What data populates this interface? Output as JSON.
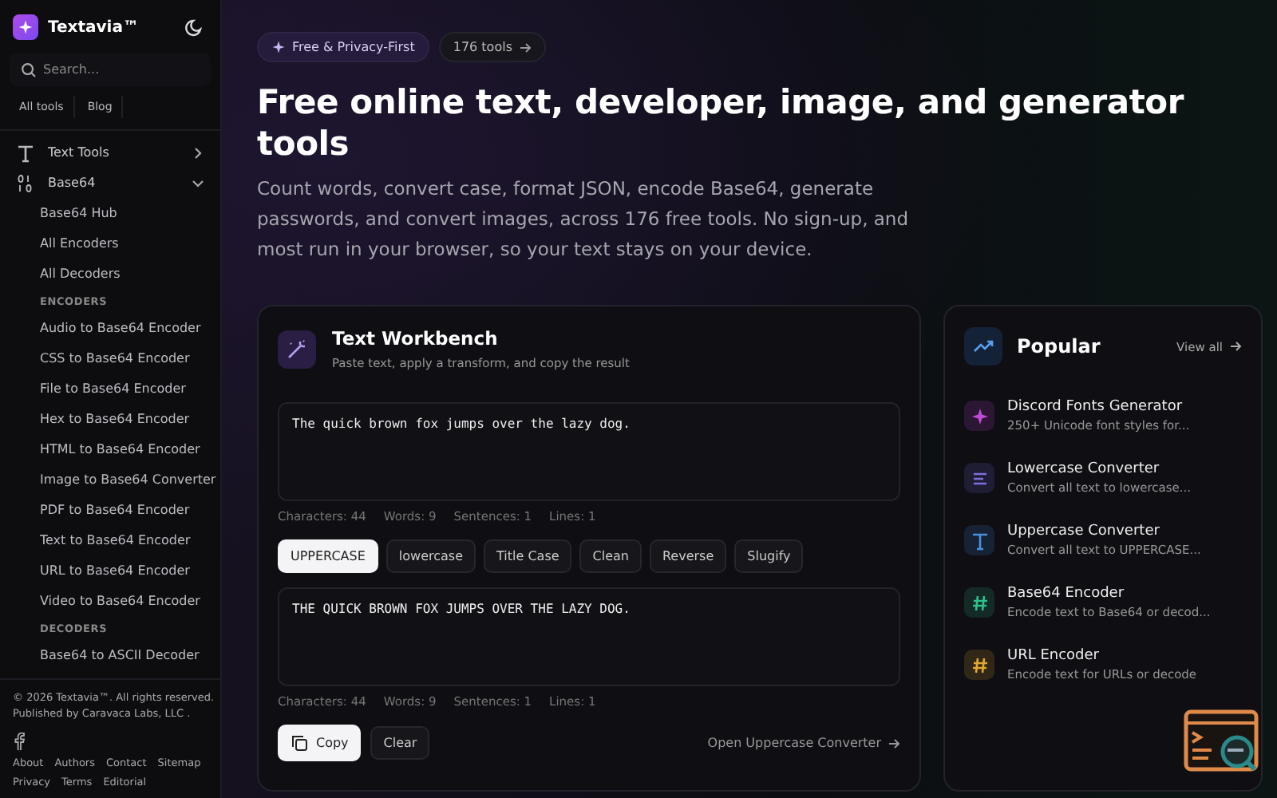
{
  "brand": {
    "name": "Textavia™"
  },
  "search": {
    "placeholder": "Search..."
  },
  "top_links": [
    "All tools",
    "Blog"
  ],
  "nav": [
    {
      "label": "Text Tools",
      "expanded": false
    },
    {
      "label": "Base64",
      "expanded": true,
      "children": [
        {
          "kind": "link",
          "label": "Base64 Hub"
        },
        {
          "kind": "link",
          "label": "All Encoders"
        },
        {
          "kind": "link",
          "label": "All Decoders"
        },
        {
          "kind": "heading",
          "label": "ENCODERS"
        },
        {
          "kind": "link",
          "label": "Audio to Base64 Encoder"
        },
        {
          "kind": "link",
          "label": "CSS to Base64 Encoder"
        },
        {
          "kind": "link",
          "label": "File to Base64 Encoder"
        },
        {
          "kind": "link",
          "label": "Hex to Base64 Encoder"
        },
        {
          "kind": "link",
          "label": "HTML to Base64 Encoder"
        },
        {
          "kind": "link",
          "label": "Image to Base64 Converter"
        },
        {
          "kind": "link",
          "label": "PDF to Base64 Encoder"
        },
        {
          "kind": "link",
          "label": "Text to Base64 Encoder"
        },
        {
          "kind": "link",
          "label": "URL to Base64 Encoder"
        },
        {
          "kind": "link",
          "label": "Video to Base64 Encoder"
        },
        {
          "kind": "heading",
          "label": "DECODERS"
        },
        {
          "kind": "link",
          "label": "Base64 to ASCII Decoder"
        }
      ]
    }
  ],
  "footer": {
    "copyright": "© 2026 Textavia™. All rights reserved.",
    "publisher": "Published by Caravaca Labs, LLC .",
    "links": [
      "About",
      "Authors",
      "Contact",
      "Sitemap",
      "Privacy",
      "Terms",
      "Editorial"
    ]
  },
  "hero": {
    "badge": "Free & Privacy-First",
    "count_pill": "176  tools",
    "title": "Free online text, developer, image, and generator tools",
    "description": "Count words, convert case, format JSON, encode Base64, generate passwords, and convert images, across 176 free tools. No sign-up, and most run in your browser, so your text stays on your device."
  },
  "workbench": {
    "title": "Text Workbench",
    "subtitle": "Paste text, apply a transform, and copy the result",
    "input": "The quick brown fox jumps over the lazy dog.",
    "input_stats": [
      "Characters: 44",
      "Words: 9",
      "Sentences: 1",
      "Lines: 1"
    ],
    "transforms": [
      {
        "label": "UPPERCASE",
        "selected": true
      },
      {
        "label": "lowercase",
        "selected": false
      },
      {
        "label": "Title Case",
        "selected": false
      },
      {
        "label": "Clean",
        "selected": false
      },
      {
        "label": "Reverse",
        "selected": false
      },
      {
        "label": "Slugify",
        "selected": false
      }
    ],
    "output": "THE QUICK BROWN FOX JUMPS OVER THE LAZY DOG.",
    "output_stats": [
      "Characters: 44",
      "Words: 9",
      "Sentences: 1",
      "Lines: 1"
    ],
    "copy_button": "Copy",
    "clear_button": "Clear",
    "open_link": "Open Uppercase Converter"
  },
  "popular": {
    "title": "Popular",
    "view_all": "View all",
    "items": [
      {
        "name": "Discord Fonts Generator",
        "description": "250+ Unicode font styles for...",
        "color": "#c04ad8"
      },
      {
        "name": "Lowercase Converter",
        "description": "Convert all text to lowercase...",
        "color": "#7c6fe0"
      },
      {
        "name": "Uppercase Converter",
        "description": "Convert all text to UPPERCASE...",
        "color": "#4a8fe0"
      },
      {
        "name": "Base64 Encoder",
        "description": "Encode text to Base64 or decod...",
        "color": "#2fbf8a"
      },
      {
        "name": "URL Encoder",
        "description": "Encode text for URLs or decode",
        "color": "#e0a830"
      }
    ]
  }
}
